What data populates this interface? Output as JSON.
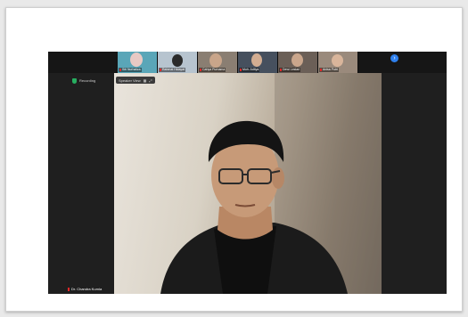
{
  "meeting": {
    "encryption_status": "Recording",
    "view_label": "Speaker View",
    "active_speaker": "Dr. Chandra Kurnia",
    "next_page_arrow": "›"
  },
  "participants": [
    {
      "label": "Siti Nurhaliza",
      "bg": "#5aa6b8"
    },
    {
      "label": "Rahmat Hidayat",
      "bg": "#b7c4cf"
    },
    {
      "label": "Cahya Purnama",
      "bg": "#8a7e72"
    },
    {
      "label": "Muh. Aditya",
      "bg": "#46505e"
    },
    {
      "label": "Dewi Lestari",
      "bg": "#6b5f57"
    },
    {
      "label": "Anisa Putri",
      "bg": "#9a8a7c"
    }
  ],
  "colors": {
    "window_bg": "#1f1f1f",
    "accent_blue": "#2f80ed",
    "mic_muted": "#e02828",
    "secure_green": "#27ae60"
  }
}
